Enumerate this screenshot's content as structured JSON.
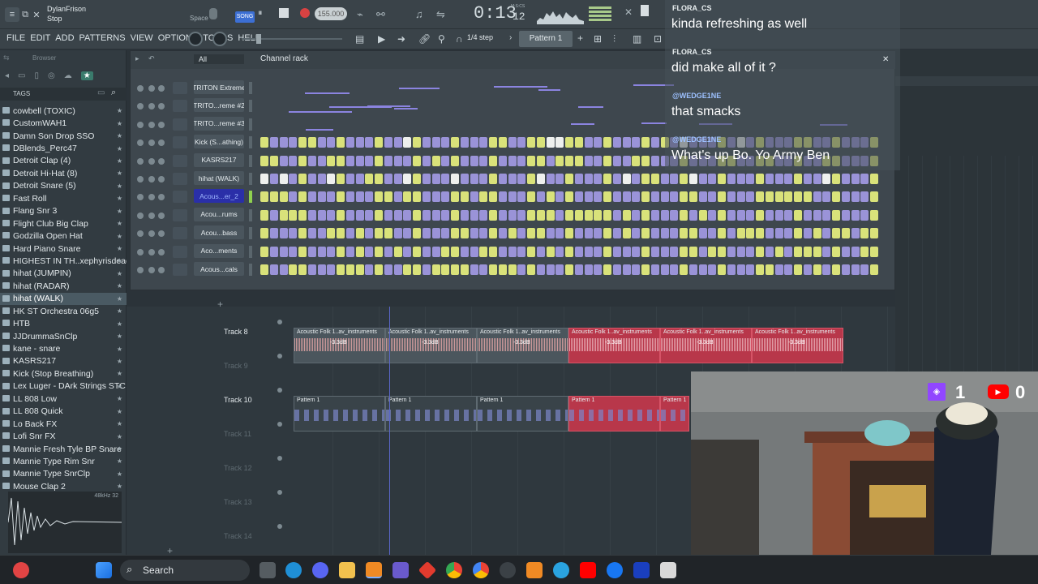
{
  "topbar": {
    "user": "DylanFrison",
    "hint": "Stop",
    "space_key": "Space",
    "song_mode": "SONG",
    "tempo": "155.000",
    "time": "0:13",
    "time_sub": "12",
    "time_unit": "M:S:CS",
    "snap": "1/4 step",
    "pattern": "Pattern 1"
  },
  "menu": {
    "items": [
      "FILE",
      "EDIT",
      "ADD",
      "PATTERNS",
      "VIEW",
      "OPTIONS",
      "TOOLS",
      "HELP"
    ]
  },
  "browser": {
    "title": "Browser",
    "filter": "All",
    "tags_label": "TAGS",
    "items": [
      "cowbell (TOXIC)",
      "CustomWAH1",
      "Damn Son Drop SSO",
      "DBlends_Perc47",
      "Detroit Clap (4)",
      "Detroit Hi-Hat (8)",
      "Detroit Snare (5)",
      "Fast Roll",
      "Flang Snr 3",
      "Flight Club Big Clap",
      "Godzilla Open Hat",
      "Hard Piano Snare",
      "HIGHEST IN TH..xephyrisdead)",
      "hihat (JUMPIN)",
      "hihat (RADAR)",
      "hihat (WALK)",
      "HK ST Orchestra 06g5",
      "HTB",
      "JJDrummaSnClp",
      "kane - snare",
      "KASRS217",
      "Kick (Stop Breathing)",
      "Lex Luger - DArk Strings STC",
      "LL 808 Low",
      "LL 808 Quick",
      "Lo Back FX",
      "Lofi Snr FX",
      "Mannie Fresh Tyle BP Snare",
      "Mannie Type Rim Snr",
      "Mannie Type SnrClp",
      "Mouse Clap 2"
    ],
    "selected_index": 15,
    "sample_info": "48kHz 32"
  },
  "rack": {
    "title": "Channel rack",
    "filter": "All",
    "channels": [
      {
        "name": "TRITON Extreme",
        "type": "roll"
      },
      {
        "name": "TRITO...reme #2",
        "type": "roll"
      },
      {
        "name": "TRITO...reme #3",
        "type": "roll"
      },
      {
        "name": "Kick (S...athing)",
        "type": "steps"
      },
      {
        "name": "KASRS217",
        "type": "steps"
      },
      {
        "name": "hihat (WALK)",
        "type": "steps"
      },
      {
        "name": "Acous...er_2",
        "type": "steps",
        "selected": true
      },
      {
        "name": "Acou...rums",
        "type": "steps"
      },
      {
        "name": "Acou...bass",
        "type": "steps"
      },
      {
        "name": "Aco...ments",
        "type": "steps"
      },
      {
        "name": "Acous...cals",
        "type": "steps"
      }
    ]
  },
  "playlist": {
    "tracks": [
      {
        "label": "Track 8",
        "active": true
      },
      {
        "label": "Track 9",
        "active": false
      },
      {
        "label": "Track 10",
        "active": true
      },
      {
        "label": "Track 11",
        "active": false
      },
      {
        "label": "Track 12",
        "active": false
      },
      {
        "label": "Track 13",
        "active": false
      },
      {
        "label": "Track 14",
        "active": false
      }
    ],
    "audio_clip_title": "Acoustic Folk 1..av_instruments",
    "audio_clip_gain": "-3.3dB",
    "pattern_clip_title": "Pattern 1"
  },
  "chat": {
    "messages": [
      {
        "user": "FLORA_CS",
        "text": "kinda refreshing as well"
      },
      {
        "user": "FLORA_CS",
        "text": "did make all of it ?"
      },
      {
        "user": "@WEDGE1NE",
        "text": "that smacks"
      },
      {
        "user": "@WEDGE1NE",
        "text": "What's up Bo. Yo Army Ben"
      }
    ]
  },
  "stream": {
    "twitch_count": "1",
    "youtube_count": "0"
  },
  "taskbar": {
    "search_label": "Search"
  }
}
